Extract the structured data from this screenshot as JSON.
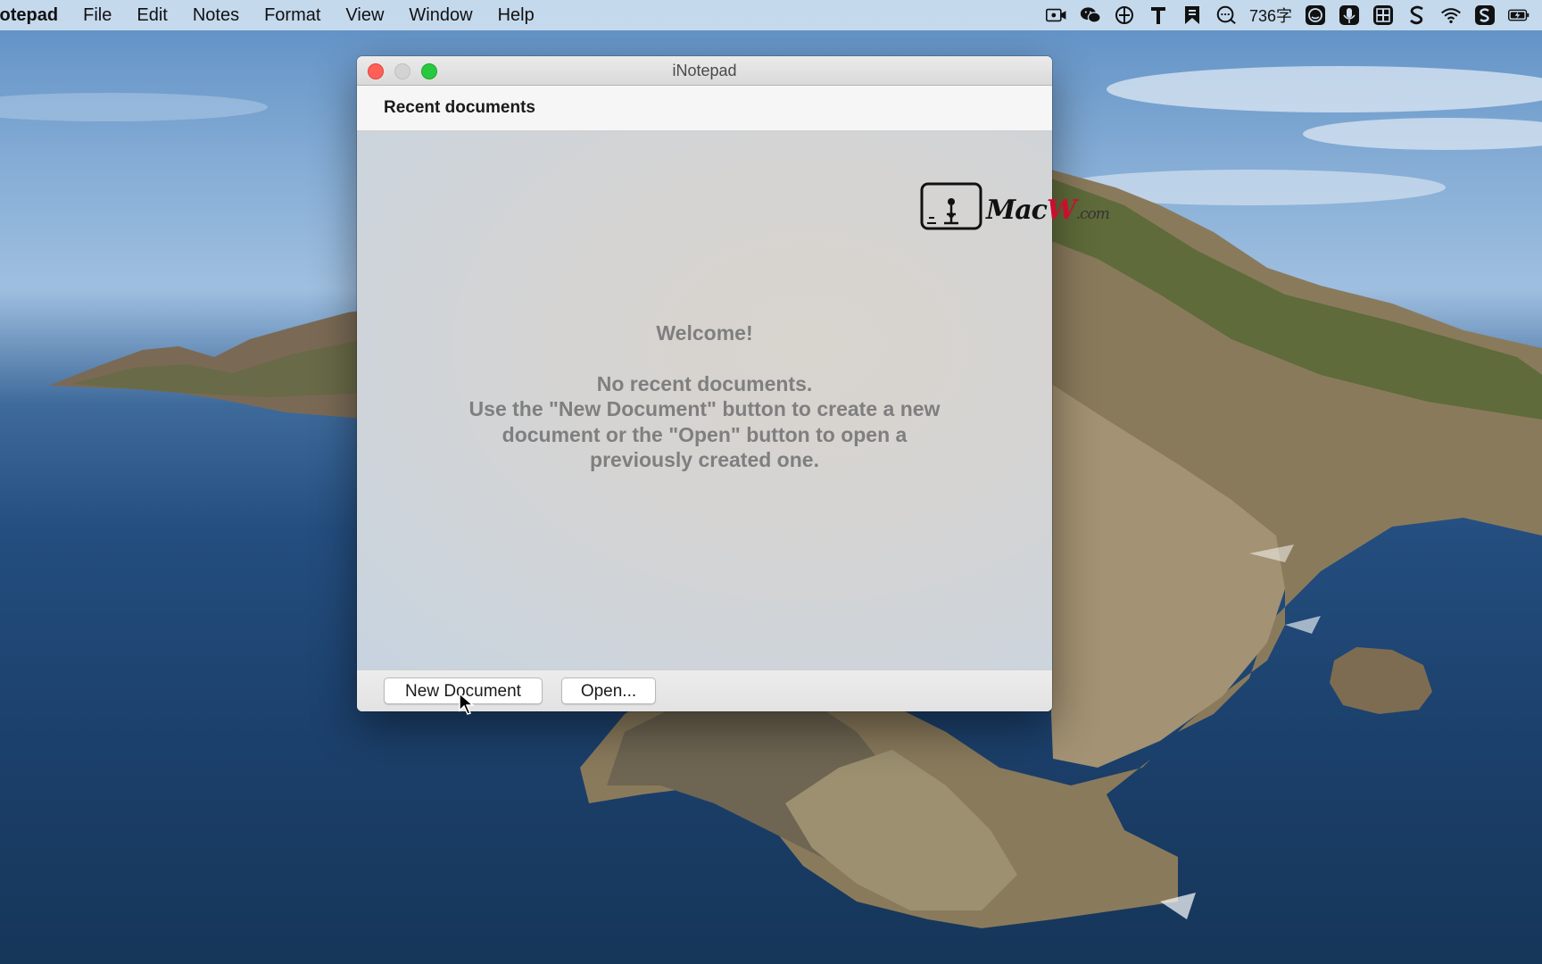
{
  "menubar": {
    "app_name": "lotepad",
    "items": [
      "File",
      "Edit",
      "Notes",
      "Format",
      "View",
      "Window",
      "Help"
    ],
    "status": {
      "word_count": "736字",
      "icons": [
        "screen-record-icon",
        "wechat-icon",
        "input-method-icon",
        "text-t-icon",
        "bookmark-icon",
        "chat-bubble-icon",
        "word-count-icon",
        "face-icon",
        "microphone-icon",
        "grid-icon",
        "s-app-icon",
        "wifi-icon",
        "sogou-icon",
        "battery-charging-icon"
      ]
    }
  },
  "window": {
    "title": "iNotepad",
    "section_header": "Recent documents",
    "welcome": {
      "title": "Welcome!",
      "lines": [
        "No recent documents.",
        "Use the \"New Document\" button to create a new",
        "document or the \"Open\" button to open a",
        "previously created one."
      ]
    },
    "buttons": {
      "new_document": "New Document",
      "open": "Open..."
    }
  },
  "watermark": {
    "text_main": "Mac",
    "text_accent": "W",
    "text_suffix": ".com"
  },
  "colors": {
    "close": "#ff5f57",
    "minimize": "#d3d3d3",
    "zoom": "#28c940",
    "menubar_bg": "#cee0f0",
    "welcome_text": "#7f7f7f"
  }
}
